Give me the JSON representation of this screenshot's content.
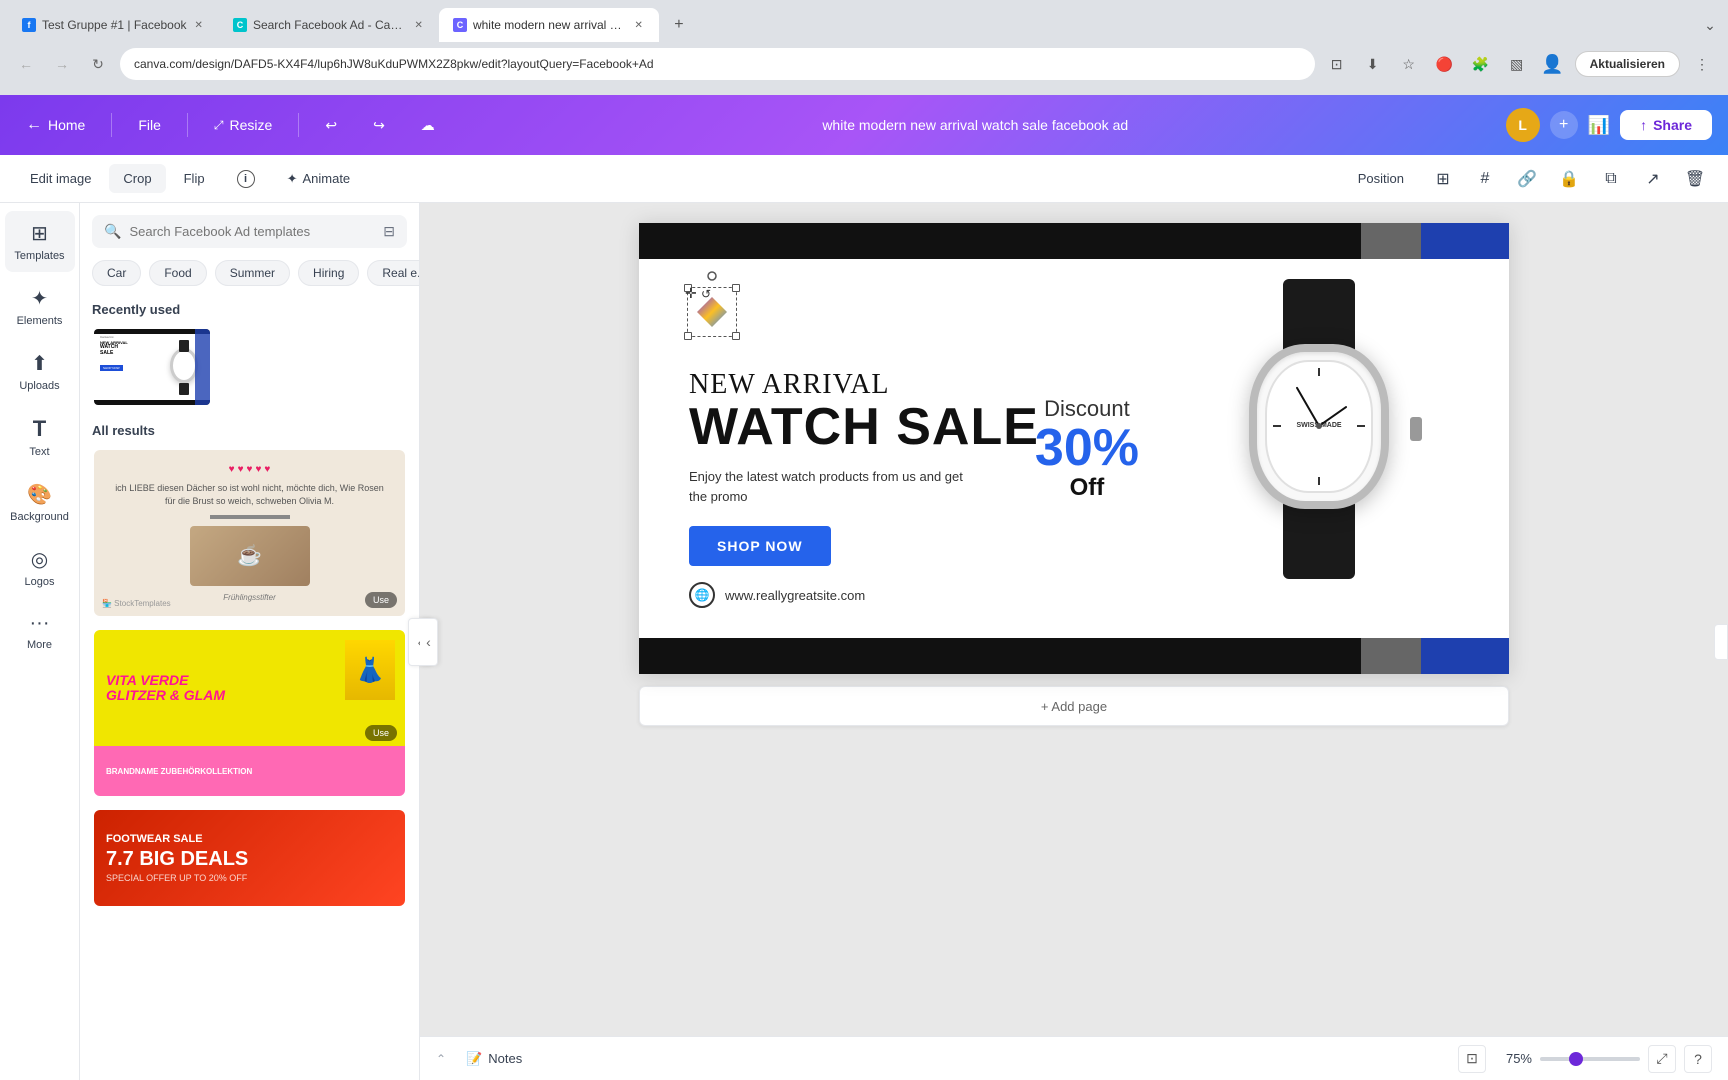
{
  "browser": {
    "tabs": [
      {
        "id": "tab1",
        "favicon_color": "#1877f2",
        "favicon_letter": "f",
        "title": "Test Gruppe #1 | Facebook",
        "active": false
      },
      {
        "id": "tab2",
        "favicon_color": "#00c4cc",
        "favicon_letter": "c",
        "title": "Search Facebook Ad - Canva",
        "active": false
      },
      {
        "id": "tab3",
        "favicon_color": "#6c63ff",
        "favicon_letter": "c",
        "title": "white modern new arrival watc...",
        "active": true
      }
    ],
    "address": "canva.com/design/DAFD5-KX4F4/lup6hJW8uKduPWMX2Z8pkw/edit?layoutQuery=Facebook+Ad",
    "update_btn": "Aktualisieren"
  },
  "app": {
    "toolbar": {
      "home": "Home",
      "file": "File",
      "resize": "Resize",
      "doc_title": "white modern new arrival watch sale facebook ad",
      "share": "Share"
    },
    "edit_toolbar": {
      "edit_image": "Edit image",
      "crop": "Crop",
      "flip": "Flip",
      "animate": "Animate",
      "position": "Position"
    },
    "sidebar": {
      "items": [
        {
          "id": "templates",
          "label": "Templates",
          "icon": "⊞"
        },
        {
          "id": "elements",
          "label": "Elements",
          "icon": "✦"
        },
        {
          "id": "uploads",
          "label": "Uploads",
          "icon": "⬆"
        },
        {
          "id": "text",
          "label": "Text",
          "icon": "T"
        },
        {
          "id": "background",
          "label": "Background",
          "icon": "🎨"
        },
        {
          "id": "logos",
          "label": "Logos",
          "icon": "◎"
        },
        {
          "id": "more",
          "label": "More",
          "icon": "···"
        }
      ]
    },
    "templates_panel": {
      "search_placeholder": "Search Facebook Ad templates",
      "tags": [
        "Car",
        "Food",
        "Summer",
        "Hiring",
        "Real e..."
      ],
      "recently_used_title": "Recently used",
      "all_results_title": "All results"
    },
    "design": {
      "headline1": "NEW ARRIVAL",
      "headline2": "WATCH SALE",
      "description": "Enjoy the latest watch products from us and get the promo",
      "shop_btn": "SHOP NOW",
      "website": "www.reallygreatsite.com",
      "discount_label": "Discount",
      "discount_percent": "30%",
      "discount_off": "Off"
    },
    "canvas": {
      "add_page": "+ Add page"
    },
    "notes": {
      "label": "Notes"
    },
    "zoom": {
      "level": "75%"
    }
  }
}
